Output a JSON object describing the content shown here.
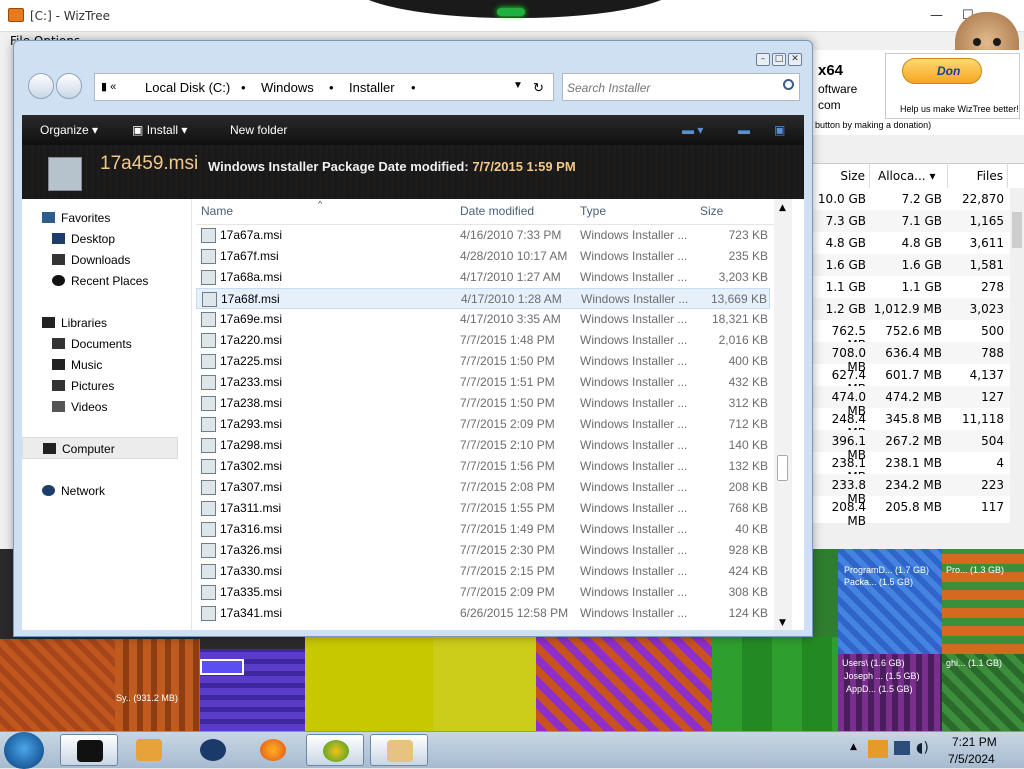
{
  "wiztree": {
    "title": "[C:] - WizTree",
    "menu": "File  Options",
    "x64": "x64",
    "software": "oftware",
    "com": "com",
    "donate_button": "Don",
    "donate_text": "Help us make WizTree better!",
    "donate_note": "button by making a donation)",
    "columns": [
      "Size",
      "Alloca...",
      "Files"
    ],
    "rows": [
      [
        "10.0 GB",
        "7.2 GB",
        "22,870"
      ],
      [
        "7.3 GB",
        "7.1 GB",
        "1,165"
      ],
      [
        "4.8 GB",
        "4.8 GB",
        "3,611"
      ],
      [
        "1.6 GB",
        "1.6 GB",
        "1,581"
      ],
      [
        "1.1 GB",
        "1.1 GB",
        "278"
      ],
      [
        "1.2 GB",
        "1,012.9 MB",
        "3,023"
      ],
      [
        "762.5 MB",
        "752.6 MB",
        "500"
      ],
      [
        "708.0 MB",
        "636.4 MB",
        "788"
      ],
      [
        "627.4 MB",
        "601.7 MB",
        "4,137"
      ],
      [
        "474.0 MB",
        "474.2 MB",
        "127"
      ],
      [
        "248.4 MB",
        "345.8 MB",
        "11,118"
      ],
      [
        "396.1 MB",
        "267.2 MB",
        "504"
      ],
      [
        "238.1 MB",
        "238.1 MB",
        "4"
      ],
      [
        "233.8 MB",
        "234.2 MB",
        "223"
      ],
      [
        "208.4 MB",
        "205.8 MB",
        "117"
      ]
    ],
    "treemap_labels": {
      "sys": "Sy.. (931.2 MB)",
      "programd": "ProgramD... (1.7 GB)",
      "packa": "Packa... (1.5 GB)",
      "pro": "Pro... (1.3 GB)",
      "users": "Users\\ (1.6 GB)",
      "joseph": "Joseph ... (1.5 GB)",
      "appd": "AppD... (1.5 GB)",
      "ghi": "ghi... (1.1 GB)"
    }
  },
  "explorer": {
    "address": {
      "crumbs": [
        "Local Disk (C:)",
        "Windows",
        "Installer"
      ],
      "search_placeholder": "Search Installer"
    },
    "toolbar": {
      "organize": "Organize",
      "install": "Install",
      "new_folder": "New folder"
    },
    "details": {
      "name": "17a459.msi",
      "type": "Windows Installer Package",
      "date_label": "Date modified:",
      "date_value": "7/7/2015 1:59 PM"
    },
    "nav": {
      "favorites": "Favorites",
      "desktop": "Desktop",
      "downloads": "Downloads",
      "recent": "Recent Places",
      "libraries": "Libraries",
      "documents": "Documents",
      "music": "Music",
      "pictures": "Pictures",
      "videos": "Videos",
      "computer": "Computer",
      "network": "Network"
    },
    "columns": {
      "name": "Name",
      "date": "Date modified",
      "type": "Type",
      "size": "Size"
    },
    "files": [
      {
        "name": "17a67a.msi",
        "date": "4/16/2010 7:33 PM",
        "type": "Windows Installer ...",
        "size": "723 KB"
      },
      {
        "name": "17a67f.msi",
        "date": "4/28/2010 10:17 AM",
        "type": "Windows Installer ...",
        "size": "235 KB"
      },
      {
        "name": "17a68a.msi",
        "date": "4/17/2010 1:27 AM",
        "type": "Windows Installer ...",
        "size": "3,203 KB"
      },
      {
        "name": "17a68f.msi",
        "date": "4/17/2010 1:28 AM",
        "type": "Windows Installer ...",
        "size": "13,669 KB"
      },
      {
        "name": "17a69e.msi",
        "date": "4/17/2010 3:35 AM",
        "type": "Windows Installer ...",
        "size": "18,321 KB"
      },
      {
        "name": "17a220.msi",
        "date": "7/7/2015 1:48 PM",
        "type": "Windows Installer ...",
        "size": "2,016 KB"
      },
      {
        "name": "17a225.msi",
        "date": "7/7/2015 1:50 PM",
        "type": "Windows Installer ...",
        "size": "400 KB"
      },
      {
        "name": "17a233.msi",
        "date": "7/7/2015 1:51 PM",
        "type": "Windows Installer ...",
        "size": "432 KB"
      },
      {
        "name": "17a238.msi",
        "date": "7/7/2015 1:50 PM",
        "type": "Windows Installer ...",
        "size": "312 KB"
      },
      {
        "name": "17a293.msi",
        "date": "7/7/2015 2:09 PM",
        "type": "Windows Installer ...",
        "size": "712 KB"
      },
      {
        "name": "17a298.msi",
        "date": "7/7/2015 2:10 PM",
        "type": "Windows Installer ...",
        "size": "140 KB"
      },
      {
        "name": "17a302.msi",
        "date": "7/7/2015 1:56 PM",
        "type": "Windows Installer ...",
        "size": "132 KB"
      },
      {
        "name": "17a307.msi",
        "date": "7/7/2015 2:08 PM",
        "type": "Windows Installer ...",
        "size": "208 KB"
      },
      {
        "name": "17a311.msi",
        "date": "7/7/2015 1:55 PM",
        "type": "Windows Installer ...",
        "size": "768 KB"
      },
      {
        "name": "17a316.msi",
        "date": "7/7/2015 1:49 PM",
        "type": "Windows Installer ...",
        "size": "40 KB"
      },
      {
        "name": "17a326.msi",
        "date": "7/7/2015 2:30 PM",
        "type": "Windows Installer ...",
        "size": "928 KB"
      },
      {
        "name": "17a330.msi",
        "date": "7/7/2015 2:15 PM",
        "type": "Windows Installer ...",
        "size": "424 KB"
      },
      {
        "name": "17a335.msi",
        "date": "7/7/2015 2:09 PM",
        "type": "Windows Installer ...",
        "size": "308 KB"
      },
      {
        "name": "17a341.msi",
        "date": "6/26/2015 12:58 PM",
        "type": "Windows Installer ...",
        "size": "124 KB"
      }
    ],
    "selected_index": 3
  },
  "taskbar": {
    "time": "7:21 PM",
    "date": "7/5/2024"
  }
}
